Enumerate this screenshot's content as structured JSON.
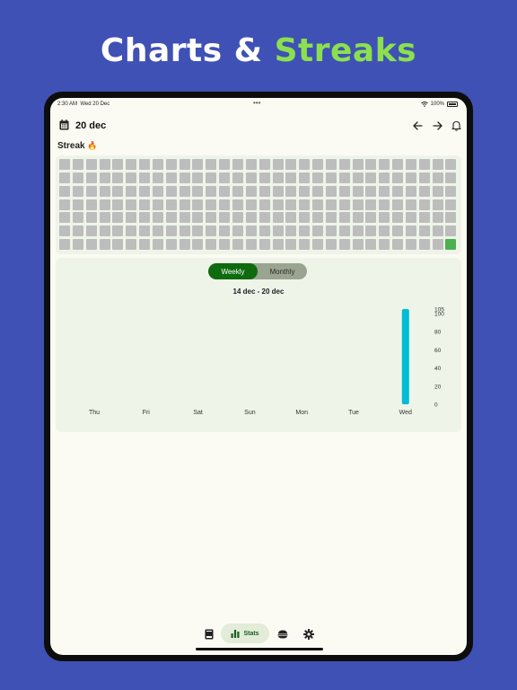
{
  "headline": {
    "part1": "Charts & ",
    "part2": "Streaks"
  },
  "colors": {
    "background": "#3f51b5",
    "accent": "#8be04e",
    "primary_green": "#0e6b0e",
    "bar": "#00bcd4",
    "cell_empty": "#bdbdbd",
    "cell_active": "#4caf50"
  },
  "status_bar": {
    "time": "2:30 AM",
    "date": "Wed 20 Dec",
    "battery": "100%",
    "dots": "•••"
  },
  "top_bar": {
    "date": "20 dec",
    "calendar_icon": "calendar-icon",
    "back_icon": "arrow-left-icon",
    "forward_icon": "arrow-right-icon",
    "notify_icon": "bell-icon"
  },
  "streak": {
    "title": "Streak",
    "emoji": "🔥",
    "rows": 7,
    "columns": 30,
    "active_cells": [
      209
    ]
  },
  "chart": {
    "toggle": {
      "options": [
        "Weekly",
        "Monthly"
      ],
      "selected": "Weekly"
    },
    "range_label": "14 dec - 20 dec"
  },
  "chart_data": {
    "type": "bar",
    "categories": [
      "Thu",
      "Fri",
      "Sat",
      "Sun",
      "Mon",
      "Tue",
      "Wed"
    ],
    "values": [
      0,
      0,
      0,
      0,
      0,
      0,
      105
    ],
    "y_ticks": [
      0,
      20,
      40,
      60,
      80,
      100,
      105
    ],
    "ylim": [
      0,
      105
    ],
    "grid": false,
    "title": "",
    "xlabel": "",
    "ylabel": ""
  },
  "bottom_nav": {
    "items": [
      {
        "icon": "book-icon"
      },
      {
        "icon": "bar-chart-icon",
        "label": "Stats",
        "active": true
      },
      {
        "icon": "food-icon"
      },
      {
        "icon": "gear-icon"
      }
    ]
  }
}
